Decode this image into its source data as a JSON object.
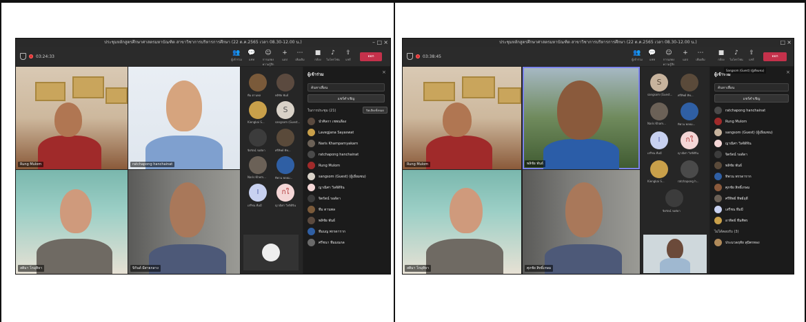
{
  "left": {
    "window_title": "ประชุมหลักสูตรศึกษาศาสตรมหาบัณฑิต สาขาวิชาการบริหารการศึกษา (22 ต.ค.2565 เวลา 08.30-12.00 น.)",
    "timer": "03:24:33",
    "toolbar": {
      "people": "ผู้เข้าร่วม",
      "chat": "แชท",
      "reactions": "การแสดงความรู้สึก",
      "apps": "แอป",
      "more": "เพิ่มเติม",
      "camera": "กล้อง",
      "mic": "ไมโครโฟน",
      "share": "แชร์",
      "leave": "ออก"
    },
    "tiles": [
      {
        "name": "Rung Mulom"
      },
      {
        "name": "ratchapong hanchainat"
      },
      {
        "name": "สติมา โกมุทิยา"
      },
      {
        "name": "นิรันด์ มีสายกลาง"
      }
    ],
    "grid": [
      {
        "label": "ทีม ตานพล"
      },
      {
        "label": "พลิชัย พันธ์"
      },
      {
        "label": "Kiengkai S..."
      },
      {
        "label": "sangsom (Guest..."
      },
      {
        "label": "จิตรัตน์ รอดัดา"
      },
      {
        "label": "ศรีทิพย์ ทิพ..."
      },
      {
        "label": "Naris Khem..."
      },
      {
        "label": "ทิพวน พลยม..."
      },
      {
        "label": "เสรีชน ทีมมี"
      },
      {
        "label": "ญาณิศา วิลจิดิจิน"
      }
    ],
    "grid_initials": [
      "S",
      "I",
      "กใ"
    ],
    "panel": {
      "title": "ผู้เข้าร่วม",
      "search_placeholder": "ค้นหาเพื่อน",
      "invite": "แชร์คำเชิญ",
      "section": "ในการประชุม (21)",
      "mute_all": "ปิดเสียงทั้งหมด",
      "participants": [
        {
          "name": "นำศิลกา เชพนลีอง"
        },
        {
          "name": "Lavegjana Sayaswat"
        },
        {
          "name": "Naris Khamparnyakarn"
        },
        {
          "name": "ratchapong hanchainat"
        },
        {
          "name": "Rung Mulom"
        },
        {
          "name": "sangsom (Guest) (ผู้เยี่ยมชม)"
        },
        {
          "name": "ญาณิศา วิลจิดิจิน"
        },
        {
          "name": "จิตรัตน์ รอดัดา"
        },
        {
          "name": "ทีม ตานพล"
        },
        {
          "name": "พลิชัย พันธ์"
        },
        {
          "name": "ทีมมญ พรรดาราก"
        },
        {
          "name": "ศรีชนา ทีมมณกล"
        }
      ]
    }
  },
  "right": {
    "window_title": "ประชุมหลักสูตรศึกษาศาสตรมหาบัณฑิต สาขาวิชาการบริหารการศึกษา (22 ต.ค.2565 เวลา 08.30-12.00 น.)",
    "timer": "03:38:45",
    "toolbar": {
      "people": "ผู้เข้าร่วม",
      "chat": "แชท",
      "reactions": "การแสดงความรู้สึก",
      "apps": "แอป",
      "more": "เพิ่มเติม",
      "camera": "กล้อง",
      "mic": "ไมโครโฟน",
      "share": "แชร์",
      "leave": "ออก"
    },
    "tiles": [
      {
        "name": "Rung Mulom"
      },
      {
        "name": "พลิชัย พันธ์"
      },
      {
        "name": "สติมา โกมุทิยา"
      },
      {
        "name": "ศุภชัย สิทธิ์เกษม"
      }
    ],
    "grid": [
      {
        "label": "sangsom (Guest..."
      },
      {
        "label": "ศรีทิพย์ ทิพ..."
      },
      {
        "label": "Naris Kham..."
      },
      {
        "label": "ทิพวน พลยม..."
      },
      {
        "label": "เสรีชน ทีมมี"
      },
      {
        "label": "ญาณิศา วิลจิดิจิน"
      },
      {
        "label": "Kiengkai S..."
      },
      {
        "label": "ratchapong h..."
      },
      {
        "label": "จิตรัตน์ รอดัดา"
      }
    ],
    "grid_initials": [
      "S",
      "I",
      "กใ"
    ],
    "panel": {
      "title": "ผู้เข้าร่วม",
      "tooltip": "Sangsom (Guest) (ผู้เยี่ยมชม)",
      "search_placeholder": "ค้นหาเพื่อน",
      "invite": "แชร์คำเชิญ",
      "section": "ไม่ได้ตอบรับ (3)",
      "participants": [
        {
          "name": "ratchapong hanchainat"
        },
        {
          "name": "Rung Mulom"
        },
        {
          "name": "sangsom (Guest) (ผู้เยี่ยมชม)"
        },
        {
          "name": "ญาณิศา วิลจิดิจิน"
        },
        {
          "name": "จิตรัตน์ รอดัดา"
        },
        {
          "name": "พลิชัย พันธ์"
        },
        {
          "name": "ทิพวน พรรดาราก"
        },
        {
          "name": "ศุภชัย สิทธิ์เกษม"
        },
        {
          "name": "ศรีทิพย์ ทิพย์ฤดี"
        },
        {
          "name": "เสรีชน ทีมมี"
        },
        {
          "name": "อาทิตย์ ทีมศิพร"
        }
      ],
      "not_responded": [
        {
          "name": "ประมวลฤทัย สุมิตรทอง"
        }
      ]
    }
  }
}
